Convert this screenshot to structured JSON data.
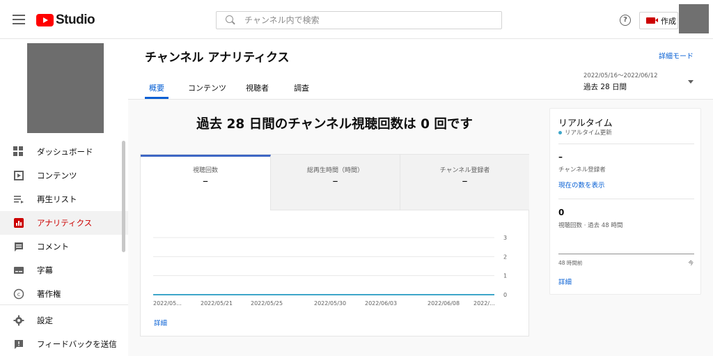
{
  "app": {
    "logo_text": "Studio",
    "brand_color": "#ff0000"
  },
  "search": {
    "placeholder": "チャンネル内で検索",
    "value": ""
  },
  "topbar": {
    "create_label": "作成"
  },
  "sidebar": {
    "items": [
      {
        "label": "ダッシュボード",
        "icon": "dashboard-icon"
      },
      {
        "label": "コンテンツ",
        "icon": "content-icon"
      },
      {
        "label": "再生リスト",
        "icon": "playlist-icon"
      },
      {
        "label": "アナリティクス",
        "icon": "analytics-icon",
        "active": true
      },
      {
        "label": "コメント",
        "icon": "comment-icon"
      },
      {
        "label": "字幕",
        "icon": "subtitles-icon"
      },
      {
        "label": "著作権",
        "icon": "copyright-icon"
      },
      {
        "label": "設定",
        "icon": "settings-icon"
      },
      {
        "label": "フィードバックを送信",
        "icon": "feedback-icon"
      }
    ]
  },
  "header": {
    "title": "チャンネル アナリティクス",
    "advanced_mode": "詳細モード",
    "tabs": [
      {
        "label": "概要",
        "active": true
      },
      {
        "label": "コンテンツ"
      },
      {
        "label": "視聴者"
      },
      {
        "label": "調査"
      }
    ],
    "date_range": {
      "dates": "2022/05/16～2022/06/12",
      "label": "過去 28 日間"
    }
  },
  "overview": {
    "headline": "過去 28 日間のチャンネル視聴回数は 0 回です",
    "metrics": [
      {
        "label": "視聴回数",
        "value": "–"
      },
      {
        "label": "総再生時間（時間）",
        "value": "–"
      },
      {
        "label": "チャンネル登録者",
        "value": "–"
      }
    ],
    "detail_link": "詳細"
  },
  "chart_data": {
    "type": "line",
    "categories": [
      "2022/05...",
      "2022/05/21",
      "2022/05/25",
      "2022/05/30",
      "2022/06/03",
      "2022/06/08",
      "2022/..."
    ],
    "series": [
      {
        "values": [
          0,
          0,
          0,
          0,
          0,
          0,
          0
        ]
      }
    ],
    "y_ticks": [
      "0",
      "1",
      "2",
      "3"
    ],
    "ylim": [
      0,
      3
    ],
    "grid": true,
    "line_color": "#3ea6c9"
  },
  "realtime": {
    "title": "リアルタイム",
    "subtitle": "リアルタイム更新",
    "subscribers_value": "–",
    "subscribers_label": "チャンネル登録者",
    "show_count_link": "現在の数を表示",
    "views_value": "0",
    "views_label": "視聴回数 · 過去 48 時間",
    "axis_left": "48 時間前",
    "axis_right": "今",
    "detail_link": "詳細"
  }
}
